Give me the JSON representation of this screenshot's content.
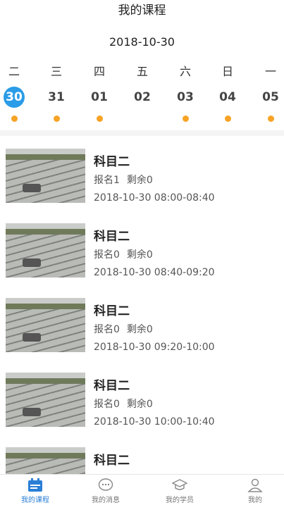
{
  "header": {
    "title": "我的课程"
  },
  "calendar": {
    "current_date": "2018-10-30",
    "weekdays": [
      "二",
      "三",
      "四",
      "五",
      "六",
      "日",
      "一"
    ],
    "days": [
      {
        "num": "30",
        "selected": true,
        "dot": true
      },
      {
        "num": "31",
        "selected": false,
        "dot": true
      },
      {
        "num": "01",
        "selected": false,
        "dot": true
      },
      {
        "num": "02",
        "selected": false,
        "dot": false
      },
      {
        "num": "03",
        "selected": false,
        "dot": true
      },
      {
        "num": "04",
        "selected": false,
        "dot": true
      },
      {
        "num": "05",
        "selected": false,
        "dot": true
      }
    ],
    "accent": "#2a9ce8",
    "dot_color": "#f7a325"
  },
  "courses": [
    {
      "name": "科目二",
      "enroll": "报名1",
      "remain": "剩余0",
      "time": "2018-10-30 08:00-08:40"
    },
    {
      "name": "科目二",
      "enroll": "报名0",
      "remain": "剩余0",
      "time": "2018-10-30 08:40-09:20"
    },
    {
      "name": "科目二",
      "enroll": "报名0",
      "remain": "剩余0",
      "time": "2018-10-30 09:20-10:00"
    },
    {
      "name": "科目二",
      "enroll": "报名0",
      "remain": "剩余0",
      "time": "2018-10-30 10:00-10:40"
    },
    {
      "name": "科目二",
      "enroll": "",
      "remain": "",
      "time": ""
    }
  ],
  "tabbar": {
    "tabs": [
      {
        "label": "我的课程",
        "icon": "calendar-icon",
        "active": true
      },
      {
        "label": "我的消息",
        "icon": "chat-icon",
        "active": false
      },
      {
        "label": "我的学员",
        "icon": "graduation-cap-icon",
        "active": false
      },
      {
        "label": "我的",
        "icon": "person-icon",
        "active": false
      }
    ],
    "active_color": "#2a7fd6"
  }
}
